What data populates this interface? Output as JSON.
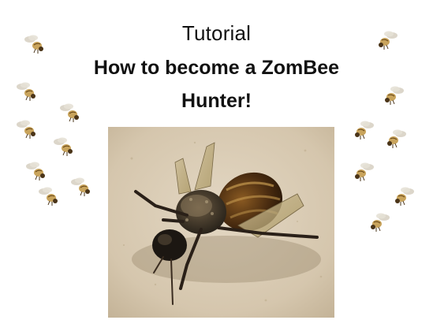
{
  "slide": {
    "subtitle": "Tutorial",
    "heading_line1": "How to become a ZomBee",
    "heading_line2": "Hunter!"
  },
  "colors": {
    "background": "#ffffff",
    "text": "#111111",
    "photo_background": "#d9ccb6",
    "fly_body": "#c9a45c"
  },
  "decoration": {
    "icon": "flying-bee-icon"
  },
  "photo": {
    "subject": "bee-photo"
  }
}
